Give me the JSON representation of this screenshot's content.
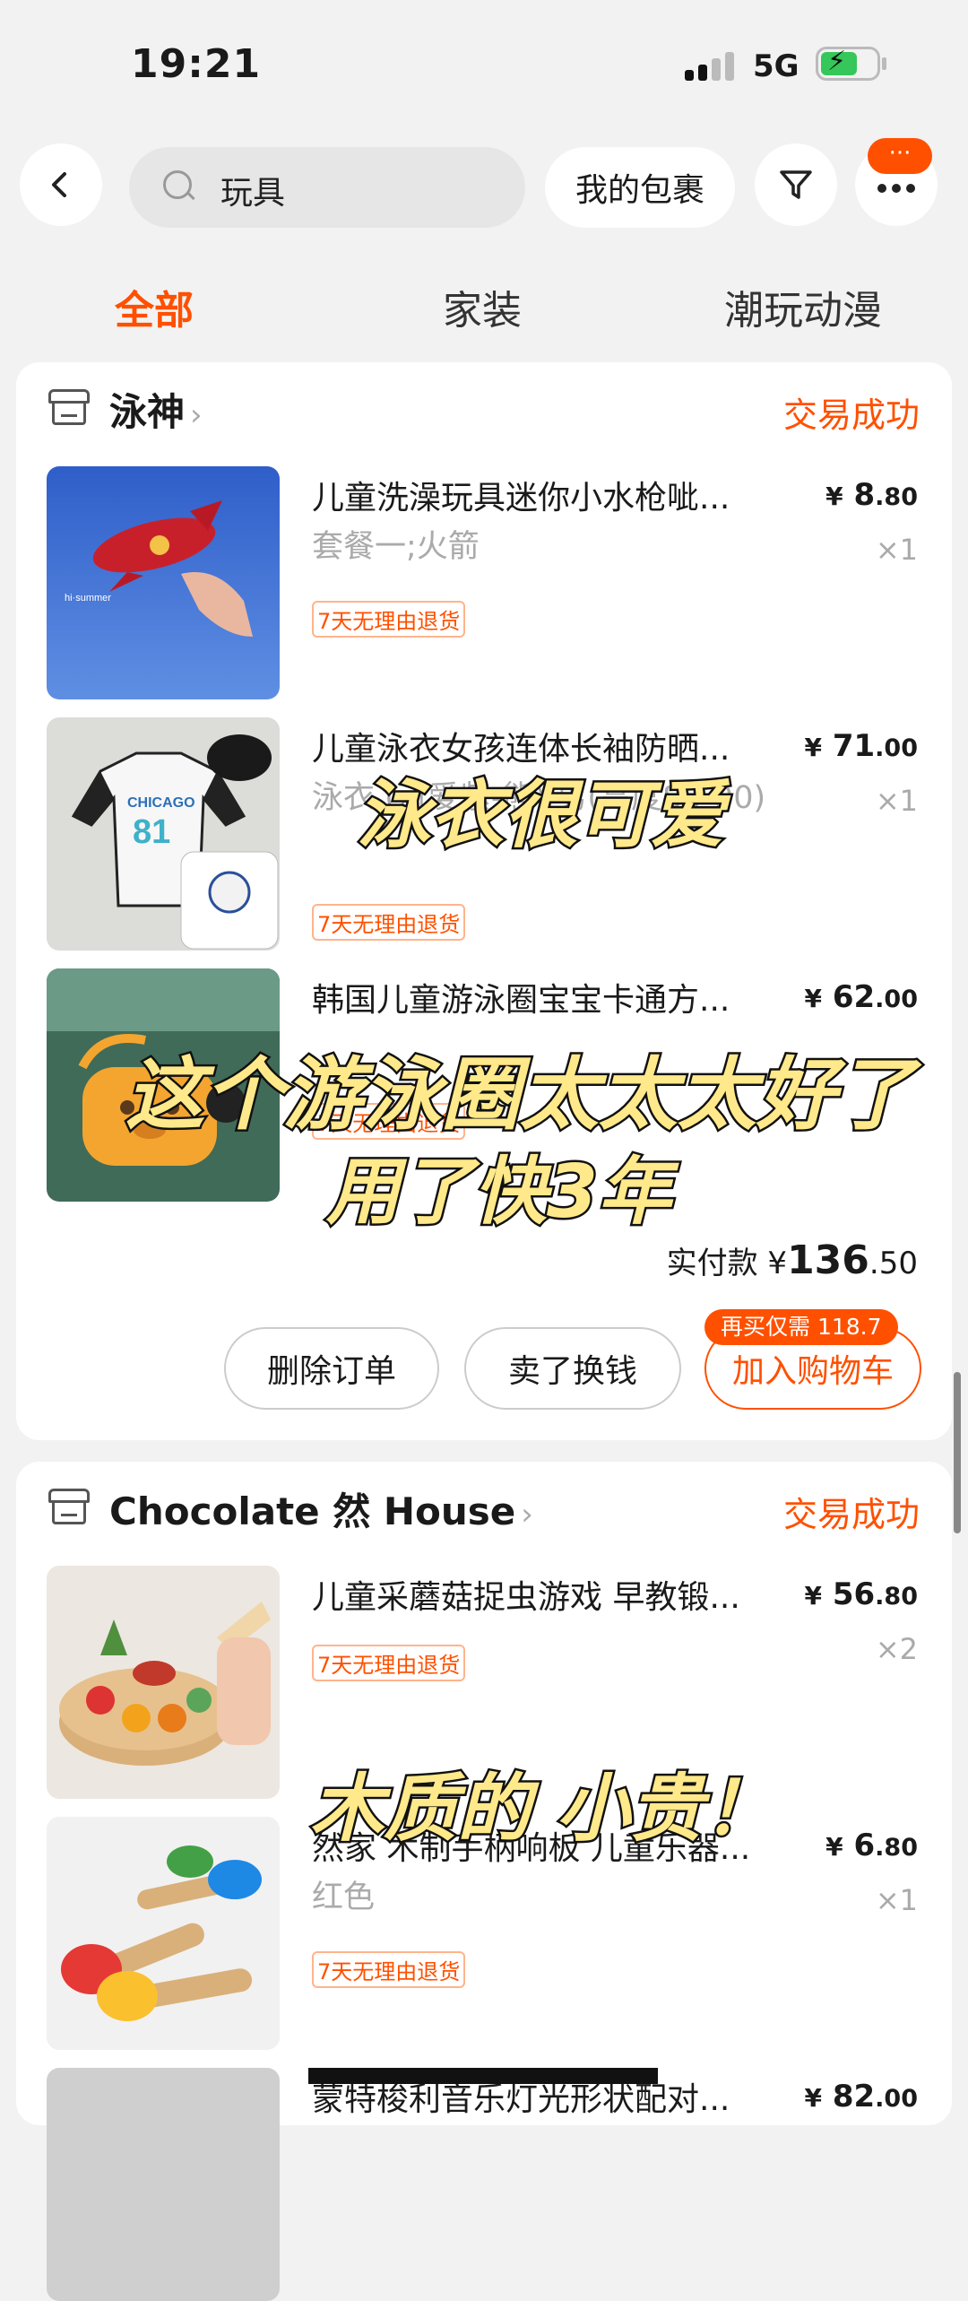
{
  "status": {
    "time": "19:21",
    "network": "5G"
  },
  "topbar": {
    "search_query": "玩具",
    "my_packages": "我的包裹",
    "more_badge": "···"
  },
  "tabs": [
    "全部",
    "家装",
    "潮玩动漫"
  ],
  "orders": [
    {
      "shop": "泳神",
      "status": "交易成功",
      "items": [
        {
          "title": "儿童洗澡玩具迷你小水枪呲...",
          "price_int": "8",
          "price_dec": ".80",
          "sku": "套餐一;火箭",
          "qty": "×1",
          "tag": "7天无理由退货"
        },
        {
          "title": "儿童泳衣女孩连体长袖防晒...",
          "price_int": "71",
          "price_dec": ".00",
          "sku": "泳衣 (可爱紫-熊) 男(高度80-90)",
          "qty": "×1",
          "tag": "7天无理由退货"
        },
        {
          "title": "韩国儿童游泳圈宝宝卡通方...",
          "price_int": "62",
          "price_dec": ".00",
          "sku": "",
          "qty": "",
          "tag": "7天无理由退货"
        }
      ],
      "total_label": "实付款",
      "total_int": "136",
      "total_dec": ".50",
      "buttons": {
        "delete": "删除订单",
        "resell": "卖了换钱",
        "add_cart": "加入购物车",
        "rebuy_tag": "再买仅需 118.7"
      }
    },
    {
      "shop": "Chocolate 然 House",
      "status": "交易成功",
      "items": [
        {
          "title": "儿童采蘑菇捉虫游戏 早教锻...",
          "price_int": "56",
          "price_dec": ".80",
          "sku": "",
          "qty": "×2",
          "tag": "7天无理由退货"
        },
        {
          "title": "然家  木制手柄响板 儿童乐器...",
          "price_int": "6",
          "price_dec": ".80",
          "sku": "红色",
          "qty": "×1",
          "tag": "7天无理由退货"
        },
        {
          "title": "蒙特梭利音乐灯光形状配对...",
          "price_int": "82",
          "price_dec": ".00"
        }
      ]
    }
  ],
  "overlays": {
    "swimsuit": "泳衣很可爱",
    "ring_line1": "这个游泳圈太太太好了",
    "ring_line2": "用了快3年",
    "wood": "木质的 小贵！"
  },
  "currency": "¥",
  "colors": {
    "accent": "#ff5000",
    "caption_fill": "#ffe98a"
  }
}
